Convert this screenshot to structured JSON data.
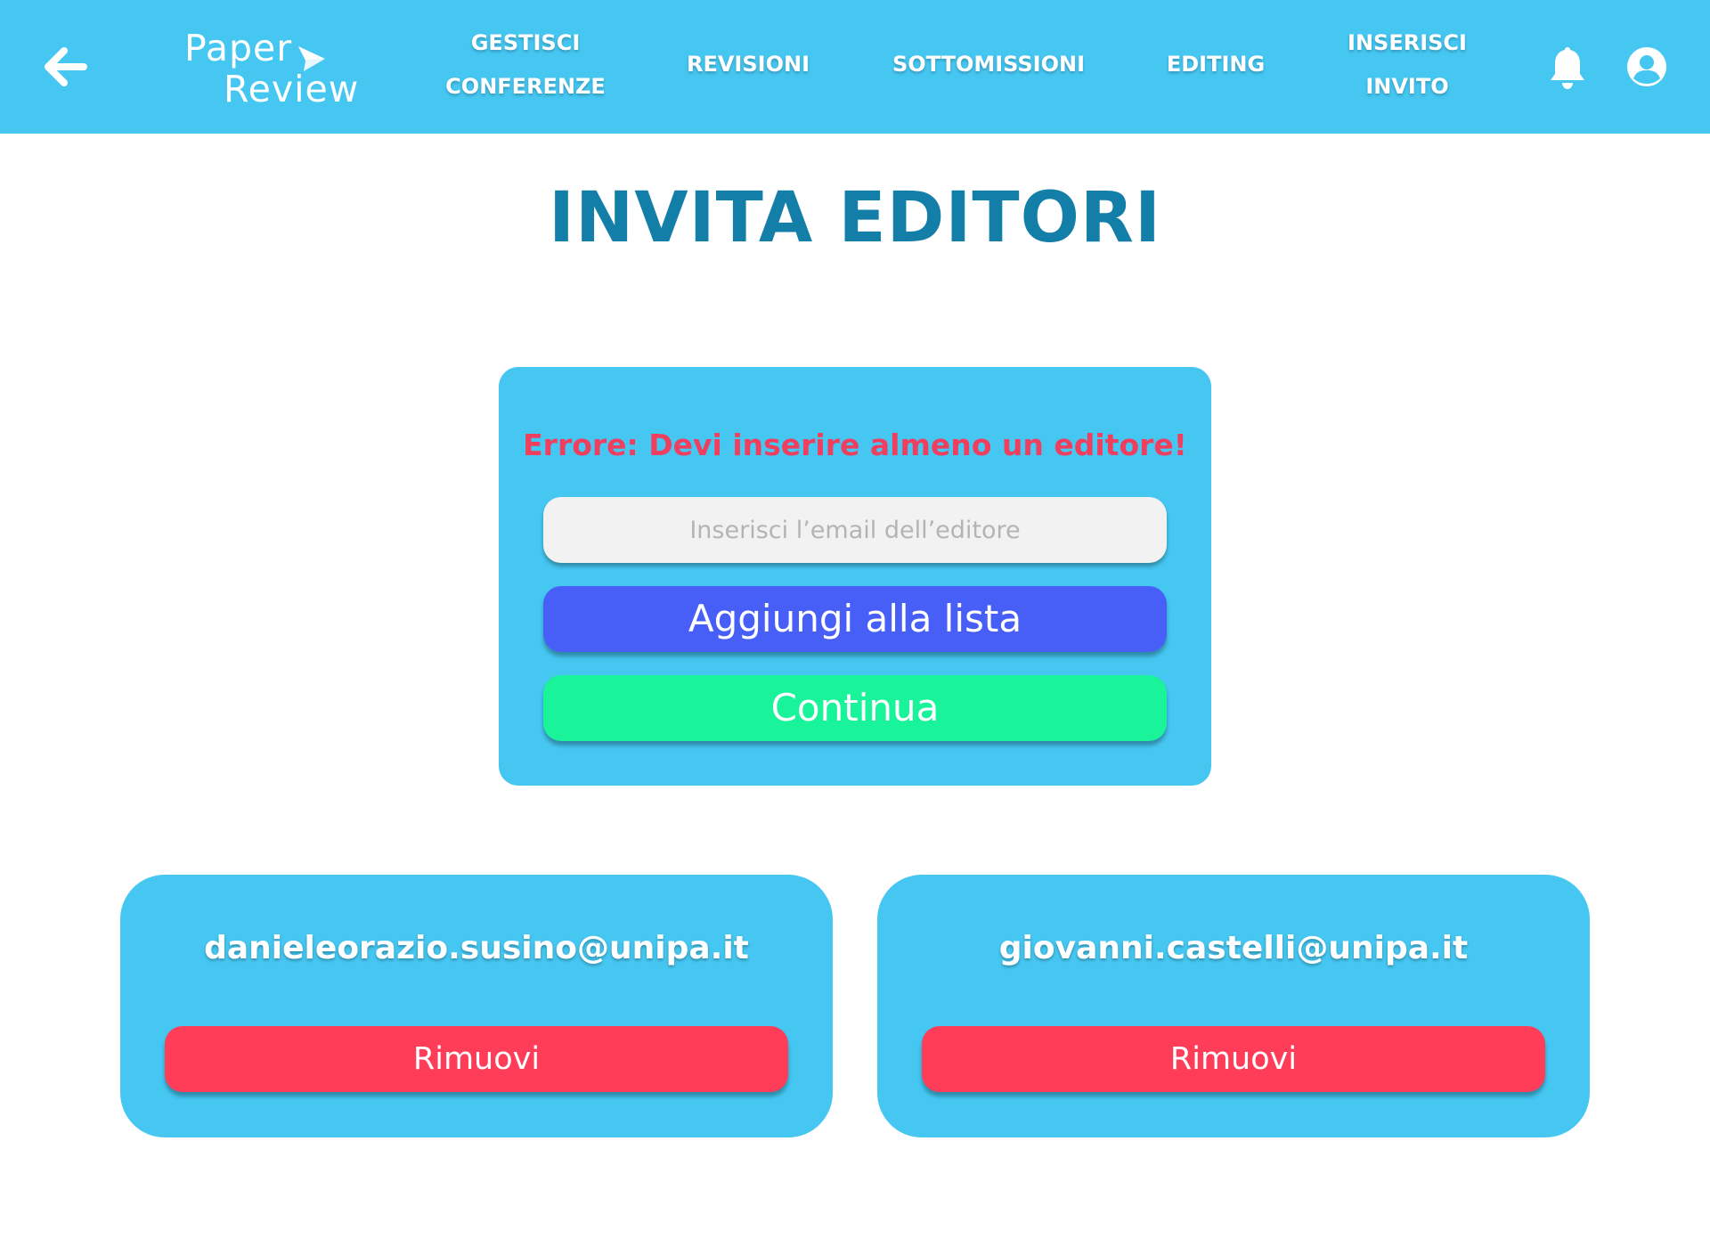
{
  "colors": {
    "navbar_bg": "#45C7F2",
    "title": "#137FA8",
    "card_bg": "#45C7F2",
    "error_text": "#F03E5E",
    "add_button": "#485FF7",
    "continue_button": "#19F39A",
    "remove_button": "#FF3D58",
    "input_bg": "#F2F2F2"
  },
  "navbar": {
    "back_icon": "arrow-left-icon",
    "logo": {
      "line1": "Paper",
      "line2": "Review",
      "icon": "paper-plane-icon"
    },
    "items": [
      {
        "label": "GESTISCI\nCONFERENZE"
      },
      {
        "label": "REVISIONI"
      },
      {
        "label": "SOTTOMISSIONI"
      },
      {
        "label": "EDITING"
      },
      {
        "label": "INSERISCI\nINVITO"
      }
    ],
    "notification_icon": "bell-icon",
    "profile_icon": "user-circle-icon"
  },
  "page": {
    "title": "INVITA EDITORI"
  },
  "invite_form": {
    "error": "Errore: Devi inserire almeno un editore!",
    "email_value": "",
    "email_placeholder": "Inserisci l’email dell’editore",
    "add_label": "Aggiungi alla lista",
    "continue_label": "Continua"
  },
  "editors": [
    {
      "email": "danieleorazio.susino@unipa.it",
      "remove_label": "Rimuovi"
    },
    {
      "email": "giovanni.castelli@unipa.it",
      "remove_label": "Rimuovi"
    }
  ]
}
